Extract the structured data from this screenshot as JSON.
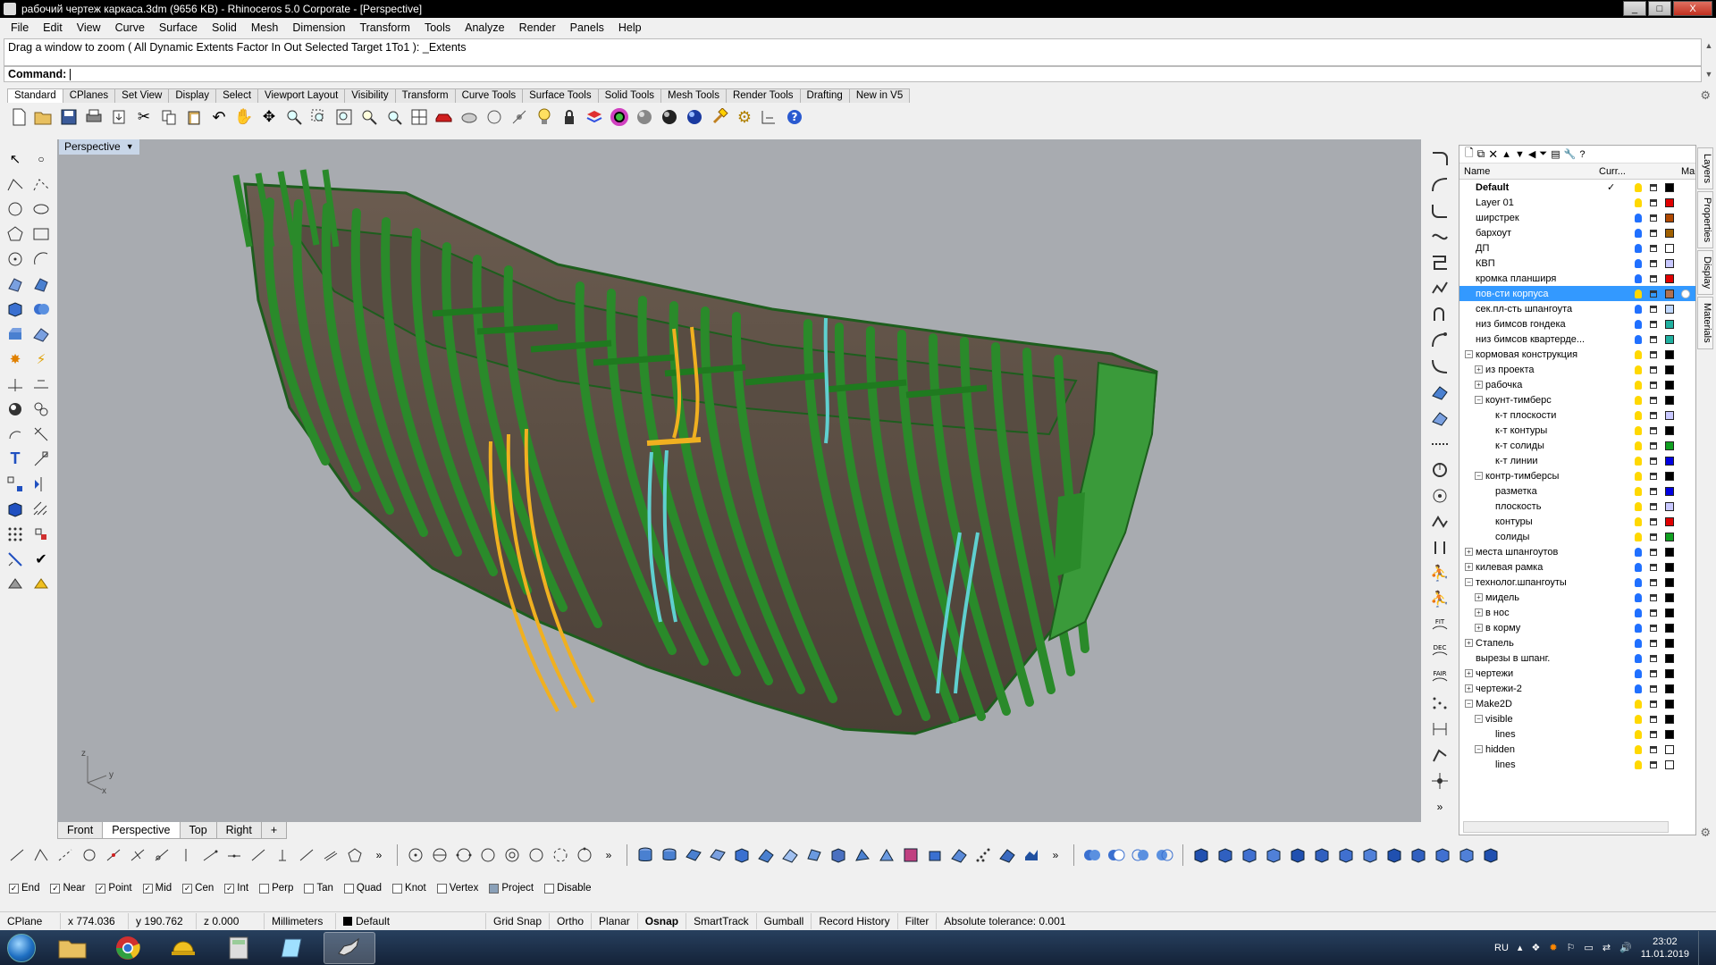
{
  "window": {
    "title": "рабочий чертеж каркаса.3dm (9656 KB) - Rhinoceros  5.0 Corporate - [Perspective]",
    "btn_min": "_",
    "btn_max": "□",
    "btn_close": "X"
  },
  "menu": [
    "File",
    "Edit",
    "View",
    "Curve",
    "Surface",
    "Solid",
    "Mesh",
    "Dimension",
    "Transform",
    "Tools",
    "Analyze",
    "Render",
    "Panels",
    "Help"
  ],
  "command": {
    "history": "Drag a window to zoom ( All  Dynamic  Extents  Factor  In  Out  Selected  Target  1To1 ): _Extents",
    "label": "Command:",
    "value": ""
  },
  "toolbar_tabs": [
    "Standard",
    "CPlanes",
    "Set View",
    "Display",
    "Select",
    "Viewport Layout",
    "Visibility",
    "Transform",
    "Curve Tools",
    "Surface Tools",
    "Solid Tools",
    "Mesh Tools",
    "Render Tools",
    "Drafting",
    "New in V5"
  ],
  "active_toolbar_tab": "Standard",
  "viewport": {
    "label": "Perspective",
    "axis_z": "z",
    "axis_y": "y",
    "axis_x": "x",
    "tabs": [
      "Front",
      "Perspective",
      "Top",
      "Right"
    ],
    "active_tab": "Perspective",
    "add_tab": "+"
  },
  "layers": {
    "headers": {
      "name": "Name",
      "current": "Curr...",
      "material": "Ma"
    },
    "rows": [
      {
        "name": "Default",
        "indent": 0,
        "bold": true,
        "current": "✓",
        "color": "#000000",
        "bulb": "#ffd800",
        "expander": ""
      },
      {
        "name": "Layer 01",
        "indent": 0,
        "color": "#e00000",
        "bulb": "#ffd800",
        "expander": ""
      },
      {
        "name": "ширстрек",
        "indent": 0,
        "color": "#b04800",
        "bulb": "#2070ff",
        "expander": ""
      },
      {
        "name": "бархоут",
        "indent": 0,
        "color": "#a06000",
        "bulb": "#2070ff",
        "expander": ""
      },
      {
        "name": "ДП",
        "indent": 0,
        "color": "#ffffff",
        "bulb": "#2070ff",
        "expander": ""
      },
      {
        "name": "КВП",
        "indent": 0,
        "color": "#c8c8ff",
        "bulb": "#2070ff",
        "expander": ""
      },
      {
        "name": "кромка планширя",
        "indent": 0,
        "color": "#e00000",
        "bulb": "#2070ff",
        "expander": ""
      },
      {
        "name": "пов-сти корпуса",
        "indent": 0,
        "color": "#b07050",
        "bulb": "#ffd800",
        "expander": "",
        "selected": true
      },
      {
        "name": "сек.пл-сть шпангоута",
        "indent": 0,
        "color": "#c0d8ff",
        "bulb": "#2070ff",
        "expander": ""
      },
      {
        "name": "низ бимсов гондека",
        "indent": 0,
        "color": "#20b0a0",
        "bulb": "#2070ff",
        "expander": ""
      },
      {
        "name": "низ бимсов квартерде...",
        "indent": 0,
        "color": "#20b0a0",
        "bulb": "#2070ff",
        "expander": ""
      },
      {
        "name": "кормовая конструкция",
        "indent": 0,
        "color": "#000000",
        "bulb": "#ffd800",
        "expander": "−"
      },
      {
        "name": "из проекта",
        "indent": 1,
        "color": "#000000",
        "bulb": "#ffd800",
        "expander": "+"
      },
      {
        "name": "рабочка",
        "indent": 1,
        "color": "#000000",
        "bulb": "#ffd800",
        "expander": "+"
      },
      {
        "name": "коунт-тимберс",
        "indent": 1,
        "color": "#000000",
        "bulb": "#ffd800",
        "expander": "−"
      },
      {
        "name": "к-т плоскости",
        "indent": 2,
        "color": "#c8c8ff",
        "bulb": "#ffd800",
        "expander": ""
      },
      {
        "name": "к-т контуры",
        "indent": 2,
        "color": "#000000",
        "bulb": "#ffd800",
        "expander": ""
      },
      {
        "name": "к-т солиды",
        "indent": 2,
        "color": "#10a020",
        "bulb": "#ffd800",
        "expander": ""
      },
      {
        "name": "к-т линии",
        "indent": 2,
        "color": "#0000e0",
        "bulb": "#ffd800",
        "expander": ""
      },
      {
        "name": "контр-тимберсы",
        "indent": 1,
        "color": "#000000",
        "bulb": "#ffd800",
        "expander": "−"
      },
      {
        "name": "разметка",
        "indent": 2,
        "color": "#0000e0",
        "bulb": "#ffd800",
        "expander": ""
      },
      {
        "name": "плоскость",
        "indent": 2,
        "color": "#c8c8ff",
        "bulb": "#ffd800",
        "expander": ""
      },
      {
        "name": "контуры",
        "indent": 2,
        "color": "#e00000",
        "bulb": "#ffd800",
        "expander": ""
      },
      {
        "name": "солиды",
        "indent": 2,
        "color": "#10a020",
        "bulb": "#ffd800",
        "expander": ""
      },
      {
        "name": "места шпангоутов",
        "indent": 0,
        "color": "#000000",
        "bulb": "#2070ff",
        "expander": "+"
      },
      {
        "name": "килевая рамка",
        "indent": 0,
        "color": "#000000",
        "bulb": "#2070ff",
        "expander": "+"
      },
      {
        "name": "технолог.шпангоуты",
        "indent": 0,
        "color": "#000000",
        "bulb": "#2070ff",
        "expander": "−"
      },
      {
        "name": "мидель",
        "indent": 1,
        "color": "#000000",
        "bulb": "#2070ff",
        "expander": "+"
      },
      {
        "name": "в нос",
        "indent": 1,
        "color": "#000000",
        "bulb": "#2070ff",
        "expander": "+"
      },
      {
        "name": "в корму",
        "indent": 1,
        "color": "#000000",
        "bulb": "#2070ff",
        "expander": "+"
      },
      {
        "name": "Стапель",
        "indent": 0,
        "color": "#000000",
        "bulb": "#2070ff",
        "expander": "+"
      },
      {
        "name": "вырезы в шпанг.",
        "indent": 0,
        "color": "#000000",
        "bulb": "#2070ff",
        "expander": ""
      },
      {
        "name": "чертежи",
        "indent": 0,
        "color": "#000000",
        "bulb": "#2070ff",
        "expander": "+"
      },
      {
        "name": "чертежи-2",
        "indent": 0,
        "color": "#000000",
        "bulb": "#2070ff",
        "expander": "+"
      },
      {
        "name": "Make2D",
        "indent": 0,
        "color": "#000000",
        "bulb": "#ffd800",
        "expander": "−"
      },
      {
        "name": "visible",
        "indent": 1,
        "color": "#000000",
        "bulb": "#ffd800",
        "expander": "−"
      },
      {
        "name": "lines",
        "indent": 2,
        "color": "#000000",
        "bulb": "#ffd800",
        "expander": ""
      },
      {
        "name": "hidden",
        "indent": 1,
        "color": "#ffffff",
        "bulb": "#ffd800",
        "expander": "−"
      },
      {
        "name": "lines",
        "indent": 2,
        "color": "#ffffff",
        "bulb": "#ffd800",
        "expander": ""
      }
    ]
  },
  "side_tabs": [
    "Layers",
    "Properties",
    "Display",
    "Materials"
  ],
  "osnap": [
    {
      "label": "End",
      "checked": true
    },
    {
      "label": "Near",
      "checked": true
    },
    {
      "label": "Point",
      "checked": true
    },
    {
      "label": "Mid",
      "checked": true
    },
    {
      "label": "Cen",
      "checked": true
    },
    {
      "label": "Int",
      "checked": true
    },
    {
      "label": "Perp",
      "checked": false
    },
    {
      "label": "Tan",
      "checked": false
    },
    {
      "label": "Quad",
      "checked": false
    },
    {
      "label": "Knot",
      "checked": false
    },
    {
      "label": "Vertex",
      "checked": false
    },
    {
      "label": "Project",
      "checked": false
    },
    {
      "label": "Disable",
      "checked": false
    }
  ],
  "status": {
    "cplane": "CPlane",
    "x": "x 774.036",
    "y": "y 190.762",
    "z": "z 0.000",
    "units": "Millimeters",
    "layer": "Default",
    "grid_snap": "Grid Snap",
    "ortho": "Ortho",
    "planar": "Planar",
    "osnap": "Osnap",
    "smarttrack": "SmartTrack",
    "gumball": "Gumball",
    "record_history": "Record History",
    "filter": "Filter",
    "tolerance": "Absolute tolerance: 0.001"
  },
  "taskbar": {
    "lang": "RU",
    "time": "23:02",
    "date": "11.01.2019"
  },
  "colors": {
    "hull_green": "#2a8a2a",
    "hull_dark": "#5a4e44",
    "highlight_yellow": "#f0b020",
    "highlight_cyan": "#5fd0d0",
    "viewport_bg": "#a8abb0"
  }
}
